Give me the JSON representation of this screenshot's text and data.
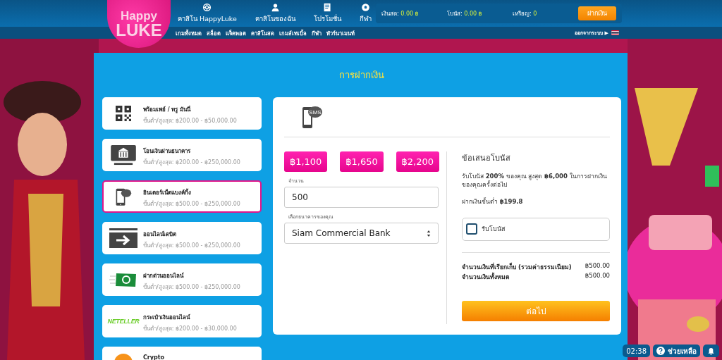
{
  "logo": {
    "line1": "Happy",
    "line2": "LUKE"
  },
  "nav": [
    {
      "label": "คาสิโน HappyLuke",
      "kind": "wheel"
    },
    {
      "label": "คาสิโนของฉัน",
      "kind": "person"
    },
    {
      "label": "โปรโมชั่น",
      "kind": "document"
    },
    {
      "label": "กีฬา",
      "kind": "ball"
    }
  ],
  "balances": [
    {
      "label": "เงินสด:",
      "value": "0.00 ฿"
    },
    {
      "label": "โบนัส:",
      "value": "0.00 ฿"
    },
    {
      "label": "เหรียญ:",
      "value": "0"
    }
  ],
  "deposit_button": "ฝากเงิน",
  "subnav": [
    "เกมทั้งหมด",
    "สล็อต",
    "แจ็คพอต",
    "คาสิโนสด",
    "เกมส์เทเบิ้ล",
    "กีฬา",
    "ทัวร์นาเมนท์"
  ],
  "logout": {
    "label": "ออกจากระบบ",
    "arrow": "▶"
  },
  "page_title": "การฝากเงิน",
  "methods": [
    {
      "kind": "qr",
      "title": "พร้อมเพย์ / ทรู มันนี่",
      "limits": "ขั้นต่ำ/สูงสุด: ฿200.00 - ฿50,000.00",
      "selected": false
    },
    {
      "kind": "bank",
      "title": "โอนเงินผ่านธนาคาร",
      "limits": "ขั้นต่ำ/สูงสุด: ฿200.00 - ฿250,000.00",
      "selected": false
    },
    {
      "kind": "sms",
      "title": "อินเตอร์เน็ตแบงค์กิ้ง",
      "limits": "ขั้นต่ำ/สูงสุด: ฿500.00 - ฿250,000.00",
      "selected": true
    },
    {
      "kind": "card",
      "title": "ออนไลน์เดบิต",
      "limits": "ขั้นต่ำ/สูงสุด: ฿500.00 - ฿250,000.00",
      "selected": false
    },
    {
      "kind": "cash",
      "title": "ฝากด่วนออนไลน์",
      "limits": "ขั้นต่ำ/สูงสุด: ฿500.00 - ฿250,000.00",
      "selected": false
    },
    {
      "kind": "neteller",
      "logo": "NETELLER",
      "title": "กระเป๋าเงินออนไลน์",
      "limits": "ขั้นต่ำ/สูงสุด: ฿200.00 - ฿30,000.00",
      "selected": false
    },
    {
      "kind": "crypto",
      "title": "Crypto",
      "selected": false
    }
  ],
  "form": {
    "icon_text": "SMS",
    "amount_buttons": [
      "฿1,100",
      "฿1,650",
      "฿2,200"
    ],
    "amount": {
      "label": "จำนวน",
      "value": "500"
    },
    "bank": {
      "label": "เลือกธนาคารของคุณ",
      "value": "Siam Commercial Bank"
    }
  },
  "bonus": {
    "title": "ข้อเสนอโบนัส",
    "text": "รับโบนัส **200%** ของคุณ สูงสุด **฿6,000** ในการฝากเงินของคุณครั้งต่อไป",
    "minimum": "ฝากเงินขั้นต่ำ **฿199.8**",
    "checkbox": {
      "label": "รับโบนัส",
      "checked": false
    }
  },
  "summary": [
    {
      "label": "จำนวนเงินที่เรียกเก็บ (รวมค่าธรรมเนียม)",
      "value": "฿500.00"
    },
    {
      "label": "จำนวนเงินทั้งหมด",
      "value": "฿500.00"
    }
  ],
  "continue_button": "ต่อไป",
  "footer": {
    "time": "02:38",
    "help": "ช่วยเหลือ"
  }
}
